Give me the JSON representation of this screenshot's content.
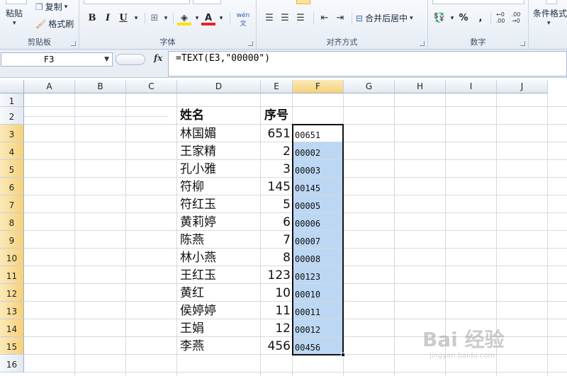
{
  "ribbon": {
    "clipboard": {
      "paste": "粘贴",
      "copy": "复制",
      "format_painter": "格式刷",
      "title": "剪贴板"
    },
    "font": {
      "bold": "B",
      "italic": "I",
      "underline": "U",
      "font_color": "A",
      "wen": "wén",
      "title": "字体"
    },
    "alignment": {
      "merge_center": "合并后居中",
      "title": "对齐方式"
    },
    "number": {
      "percent": "%",
      "comma": ",",
      "title": "数字"
    },
    "styles": {
      "conditional_format": "条件格式"
    }
  },
  "formula_bar": {
    "name_box": "F3",
    "fx": "fx",
    "formula": "=TEXT(E3,\"00000\")"
  },
  "columns": [
    "A",
    "B",
    "C",
    "D",
    "E",
    "F",
    "G",
    "H",
    "I",
    "J"
  ],
  "selected_column": "F",
  "rows": [
    "1",
    "2",
    "3",
    "4",
    "5",
    "6",
    "7",
    "8",
    "9",
    "10",
    "11",
    "12",
    "13",
    "14",
    "15",
    "16"
  ],
  "header_row": {
    "name": "姓名",
    "serial": "序号"
  },
  "table": [
    {
      "name": "林国媚",
      "serial": "651",
      "text": "00651"
    },
    {
      "name": "王家精",
      "serial": "2",
      "text": "00002"
    },
    {
      "name": "孔小雅",
      "serial": "3",
      "text": "00003"
    },
    {
      "name": "符柳",
      "serial": "145",
      "text": "00145"
    },
    {
      "name": "符红玉",
      "serial": "5",
      "text": "00005"
    },
    {
      "name": "黄莉婷",
      "serial": "6",
      "text": "00006"
    },
    {
      "name": "陈燕",
      "serial": "7",
      "text": "00007"
    },
    {
      "name": "林小燕",
      "serial": "8",
      "text": "00008"
    },
    {
      "name": "王红玉",
      "serial": "123",
      "text": "00123"
    },
    {
      "name": "黄红",
      "serial": "10",
      "text": "00010"
    },
    {
      "name": "侯婷婷",
      "serial": "11",
      "text": "00011"
    },
    {
      "name": "王娟",
      "serial": "12",
      "text": "00012"
    },
    {
      "name": "李燕",
      "serial": "456",
      "text": "00456"
    }
  ],
  "watermark": {
    "main": "Bai 经验",
    "sub": "jingyan.baidu.com"
  }
}
